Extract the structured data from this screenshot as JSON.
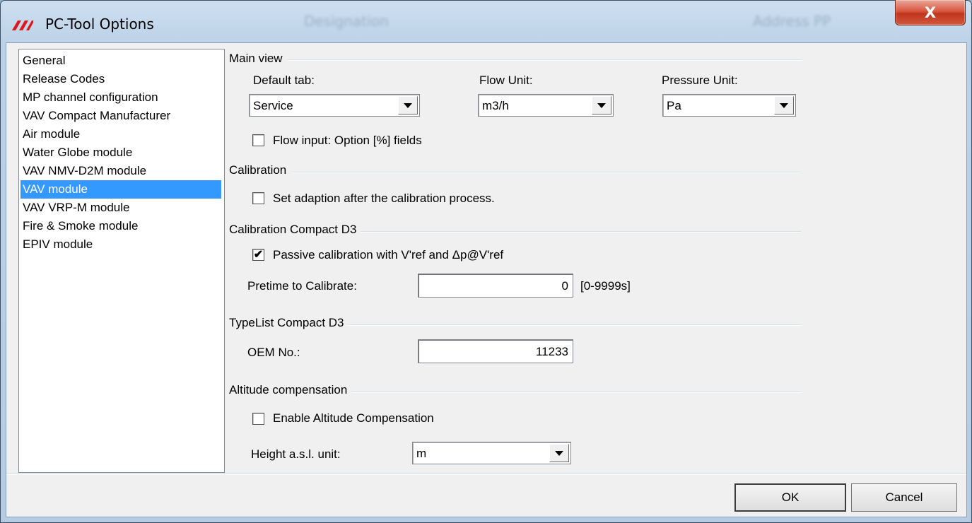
{
  "window": {
    "title": "PC-Tool Options",
    "close_glyph": "X",
    "background_headers": [
      "Designation",
      "Address PP"
    ]
  },
  "sidebar": {
    "items": [
      {
        "label": "General"
      },
      {
        "label": "Release Codes"
      },
      {
        "label": "MP channel configuration"
      },
      {
        "label": "VAV Compact Manufacturer"
      },
      {
        "label": "Air module"
      },
      {
        "label": "Water Globe module"
      },
      {
        "label": "VAV NMV-D2M module"
      },
      {
        "label": "VAV module",
        "selected": true
      },
      {
        "label": "VAV VRP-M module"
      },
      {
        "label": "Fire & Smoke module"
      },
      {
        "label": "EPIV module"
      }
    ]
  },
  "main_view": {
    "title": "Main view",
    "default_tab_label": "Default tab:",
    "default_tab_value": "Service",
    "flow_unit_label": "Flow Unit:",
    "flow_unit_value": "m3/h",
    "pressure_unit_label": "Pressure Unit:",
    "pressure_unit_value": "Pa",
    "flow_input_label": "Flow input: Option [%] fields",
    "flow_input_checked": false
  },
  "calibration": {
    "title": "Calibration",
    "set_adaption_label": "Set adaption after the calibration process.",
    "set_adaption_checked": false
  },
  "calibration_compact_d3": {
    "title": "Calibration Compact D3",
    "passive_label": "Passive calibration with V'ref and Δp@V'ref",
    "passive_checked": true,
    "pretime_label": "Pretime to Calibrate:",
    "pretime_value": "0",
    "pretime_range": "[0-9999s]"
  },
  "typelist_compact_d3": {
    "title": "TypeList Compact D3",
    "oem_label": "OEM No.:",
    "oem_value": "11233"
  },
  "altitude": {
    "title": "Altitude compensation",
    "enable_label": "Enable Altitude Compensation",
    "enable_checked": false,
    "height_unit_label": "Height a.s.l. unit:",
    "height_unit_value": "m"
  },
  "buttons": {
    "ok": "OK",
    "cancel": "Cancel"
  },
  "icons": {
    "app": "red-stripes-logo-icon",
    "close": "close-icon",
    "dropdown": "chevron-down-icon",
    "check": "checkmark-icon"
  },
  "colors": {
    "selection": "#3399ff",
    "close_button": "#c1341c",
    "dialog_bg": "#f0f0f0"
  }
}
